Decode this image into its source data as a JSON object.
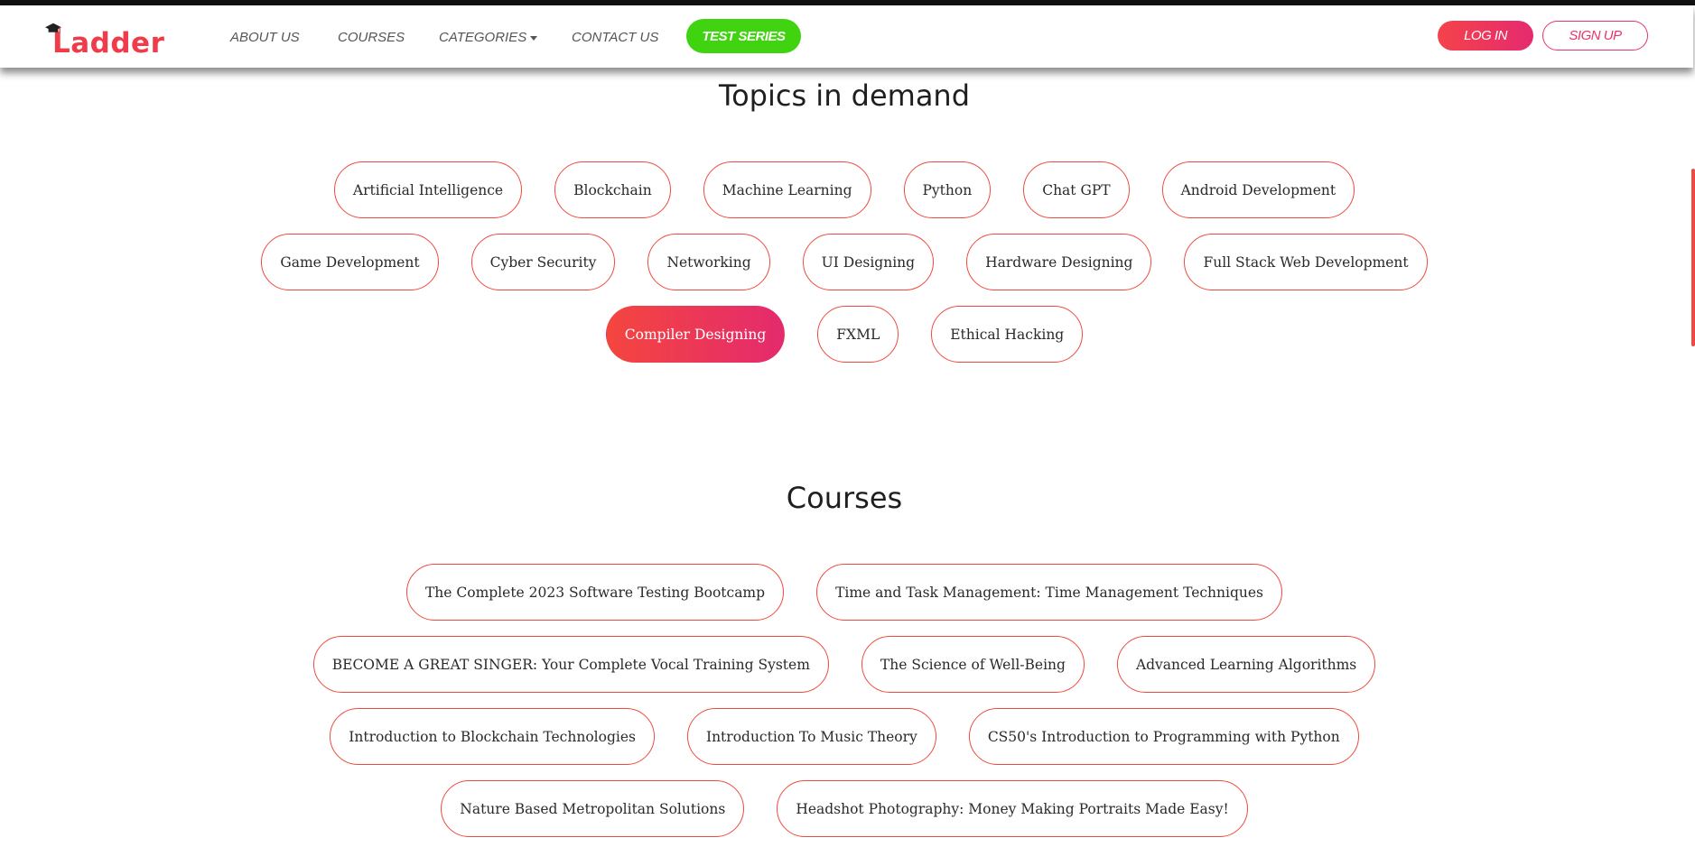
{
  "header": {
    "logo_text": "Ladder",
    "nav": {
      "about": "ABOUT US",
      "courses": "COURSES",
      "categories": "CATEGORIES",
      "contact": "CONTACT US"
    },
    "test_series": "TEST SERIES",
    "login": "LOG IN",
    "signup": "SIGN UP"
  },
  "topics": {
    "title": "Topics in demand",
    "rows": [
      [
        "Artificial Intelligence",
        "Blockchain",
        "Machine Learning",
        "Python",
        "Chat GPT",
        "Android Development"
      ],
      [
        "Game Development",
        "Cyber Security",
        "Networking",
        "UI Designing",
        "Hardware Designing",
        "Full Stack Web Development"
      ],
      [
        "Compiler Designing",
        "FXML",
        "Ethical Hacking"
      ]
    ],
    "active": "Compiler Designing"
  },
  "courses": {
    "title": "Courses",
    "rows": [
      [
        "The Complete 2023 Software Testing Bootcamp",
        "Time and Task Management: Time Management Techniques"
      ],
      [
        "BECOME A GREAT SINGER: Your Complete Vocal Training System",
        "The Science of Well-Being",
        "Advanced Learning Algorithms"
      ],
      [
        "Introduction to Blockchain Technologies",
        "Introduction To Music Theory",
        "CS50's Introduction to Programming with Python"
      ],
      [
        "Nature Based Metropolitan Solutions",
        "Headshot Photography: Money Making Portraits Made Easy!"
      ]
    ]
  },
  "colors": {
    "accent_red": "#ef4a3f",
    "accent_pink": "#e52a6f",
    "test_series_green": "#3fd40f"
  }
}
